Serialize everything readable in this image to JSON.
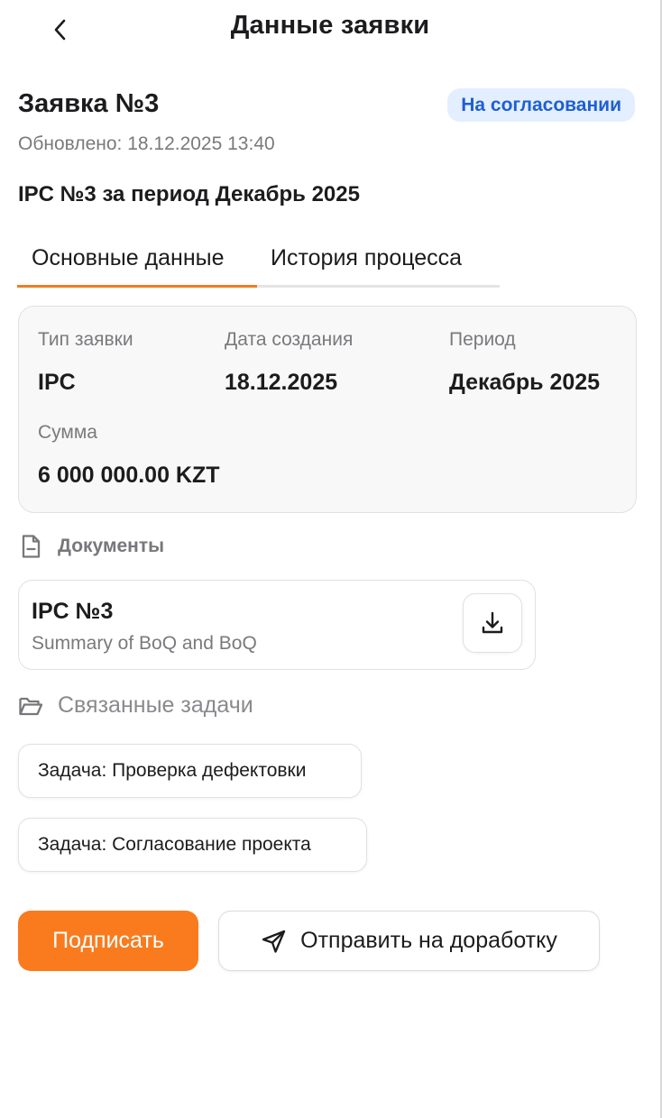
{
  "header": {
    "title": "Данные заявки",
    "back_icon": "chevron-left-icon"
  },
  "request": {
    "title": "Заявка №3",
    "status": "На согласовании",
    "status_colors": {
      "bg": "#e3efff",
      "text": "#1f5fd1"
    },
    "updated": "Обновлено: 18.12.2025 13:40",
    "subject": "IPC №3 за период Декабрь 2025"
  },
  "tabs": [
    {
      "label": "Основные данные",
      "active": true
    },
    {
      "label": "История процесса",
      "active": false
    }
  ],
  "accent_color": "#f07d22",
  "info": {
    "type_label": "Тип заявки",
    "type_value": "IPC",
    "created_label": "Дата создания",
    "created_value": "18.12.2025",
    "period_label": "Период",
    "period_value": "Декабрь 2025",
    "sum_label": "Сумма",
    "sum_value": "6 000 000.00 KZT"
  },
  "documents": {
    "section_title": "Документы",
    "section_icon": "file-icon",
    "items": [
      {
        "title": "IPC №3",
        "subtitle": "Summary of BoQ and BoQ",
        "action_icon": "download-icon"
      }
    ]
  },
  "tasks": {
    "section_title": "Связанные задачи",
    "section_icon": "folder-icon",
    "items": [
      {
        "label": "Задача: Проверка дефектовки"
      },
      {
        "label": "Задача: Согласование проекта"
      }
    ]
  },
  "actions": {
    "sign_label": "Подписать",
    "sign_color": "#f97b1e",
    "return_label": "Отправить на доработку",
    "return_icon": "send-icon"
  }
}
